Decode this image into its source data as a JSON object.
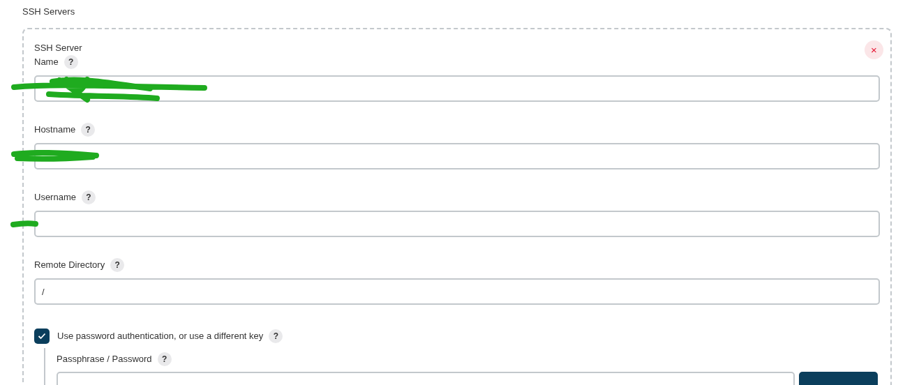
{
  "section_title": "SSH Servers",
  "server": {
    "title": "SSH Server",
    "remove": "×",
    "fields": [
      {
        "label": "Name",
        "help": "?",
        "redacted": true
      },
      {
        "label": "Hostname",
        "help": "?",
        "redacted": true
      },
      {
        "label": "Username",
        "help": "?",
        "redacted": true
      },
      {
        "label": "Remote Directory",
        "help": "?",
        "value": "/",
        "redacted": false
      }
    ],
    "password_auth": {
      "label": "Use password authentication, or use a different key",
      "help": "?",
      "checked": true
    },
    "passphrase": {
      "label": "Passphrase / Password",
      "help": "?"
    }
  }
}
